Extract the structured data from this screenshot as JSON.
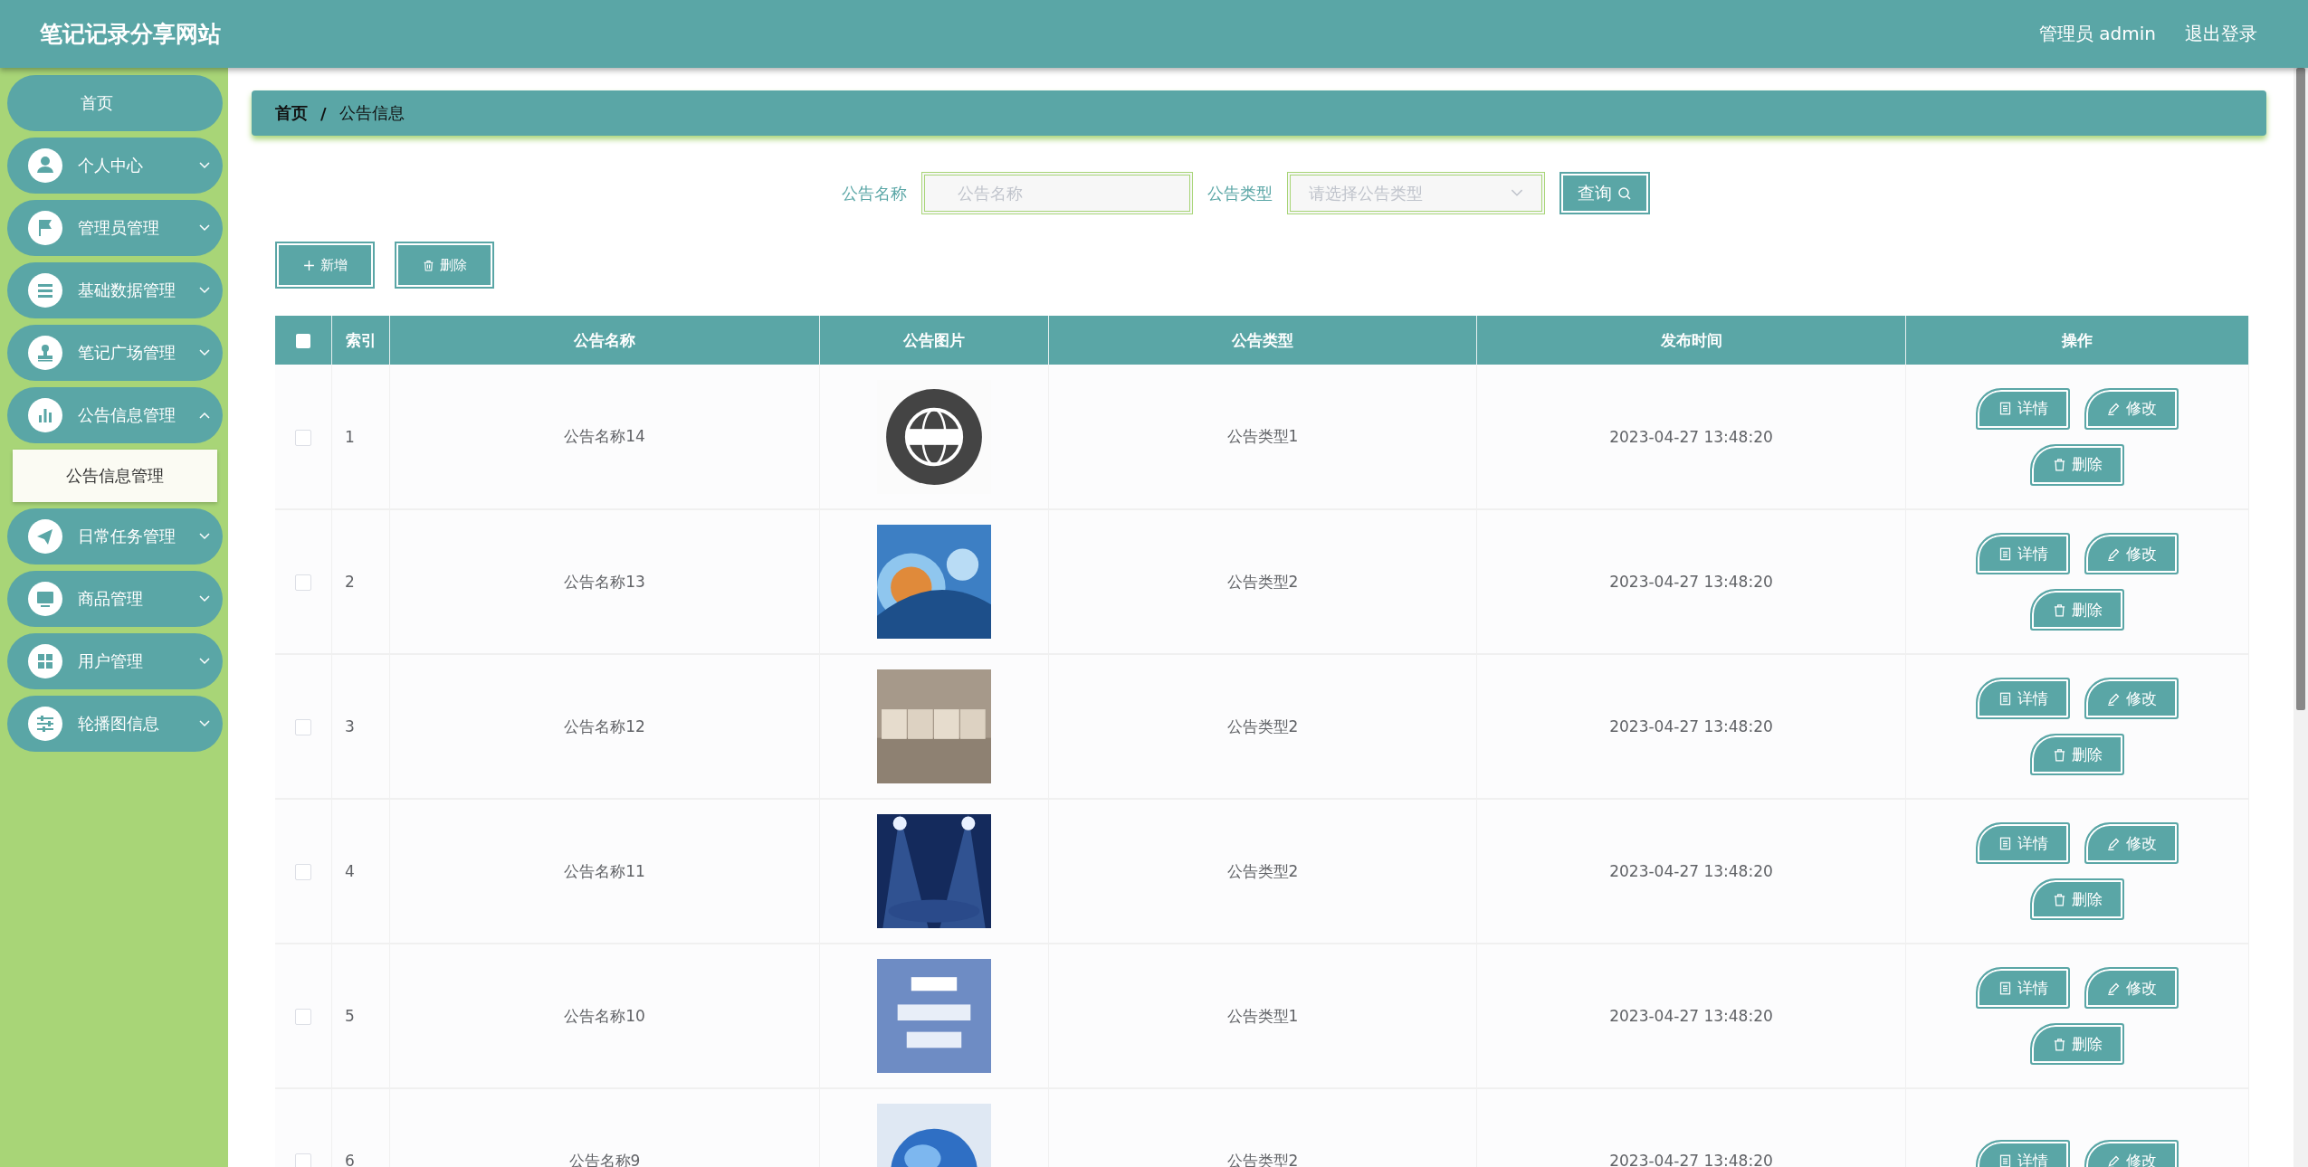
{
  "header": {
    "title": "笔记记录分享网站",
    "user": "管理员 admin",
    "logout": "退出登录"
  },
  "sidebar": {
    "items": [
      {
        "label": "首页",
        "kind": "link"
      },
      {
        "label": "个人中心",
        "kind": "menu",
        "expanded": false
      },
      {
        "label": "管理员管理",
        "kind": "menu",
        "expanded": false
      },
      {
        "label": "基础数据管理",
        "kind": "menu",
        "expanded": false
      },
      {
        "label": "笔记广场管理",
        "kind": "menu",
        "expanded": false
      },
      {
        "label": "公告信息管理",
        "kind": "menu",
        "expanded": true,
        "children": [
          {
            "label": "公告信息管理",
            "selected": true
          }
        ]
      },
      {
        "label": "日常任务管理",
        "kind": "menu",
        "expanded": false
      },
      {
        "label": "商品管理",
        "kind": "menu",
        "expanded": false
      },
      {
        "label": "用户管理",
        "kind": "menu",
        "expanded": false
      },
      {
        "label": "轮播图信息",
        "kind": "menu",
        "expanded": false
      }
    ]
  },
  "breadcrumb": {
    "items": [
      "首页",
      "公告信息"
    ],
    "separator": "/"
  },
  "search": {
    "fields": [
      {
        "label": "公告名称",
        "placeholder": "公告名称",
        "kind": "input"
      },
      {
        "label": "公告类型",
        "placeholder": "请选择公告类型",
        "kind": "select"
      }
    ],
    "button": "查询"
  },
  "toolbar": [
    "新增",
    "删除"
  ],
  "table": {
    "select_all": {
      "checked": false
    },
    "columns": [
      "索引",
      "公告名称",
      "公告图片",
      "公告类型",
      "发布时间",
      "操作"
    ],
    "rows": [
      {
        "selected": false,
        "index": "1",
        "name": "公告名称14",
        "type": "公告类型1",
        "time": "2023-04-27 13:48:20",
        "actions": [
          "详情",
          "修改",
          "删除"
        ]
      },
      {
        "selected": false,
        "index": "2",
        "name": "公告名称13",
        "type": "公告类型2",
        "time": "2023-04-27 13:48:20",
        "actions": [
          "详情",
          "修改",
          "删除"
        ]
      },
      {
        "selected": false,
        "index": "3",
        "name": "公告名称12",
        "type": "公告类型2",
        "time": "2023-04-27 13:48:20",
        "actions": [
          "详情",
          "修改",
          "删除"
        ]
      },
      {
        "selected": false,
        "index": "4",
        "name": "公告名称11",
        "type": "公告类型2",
        "time": "2023-04-27 13:48:20",
        "actions": [
          "详情",
          "修改",
          "删除"
        ]
      },
      {
        "selected": false,
        "index": "5",
        "name": "公告名称10",
        "type": "公告类型1",
        "time": "2023-04-27 13:48:20",
        "actions": [
          "详情",
          "修改",
          "删除"
        ]
      },
      {
        "selected": false,
        "index": "6",
        "name": "公告名称9",
        "type": "公告类型2",
        "time": "2023-04-27 13:48:20",
        "actions": [
          "详情",
          "修改"
        ]
      }
    ]
  }
}
